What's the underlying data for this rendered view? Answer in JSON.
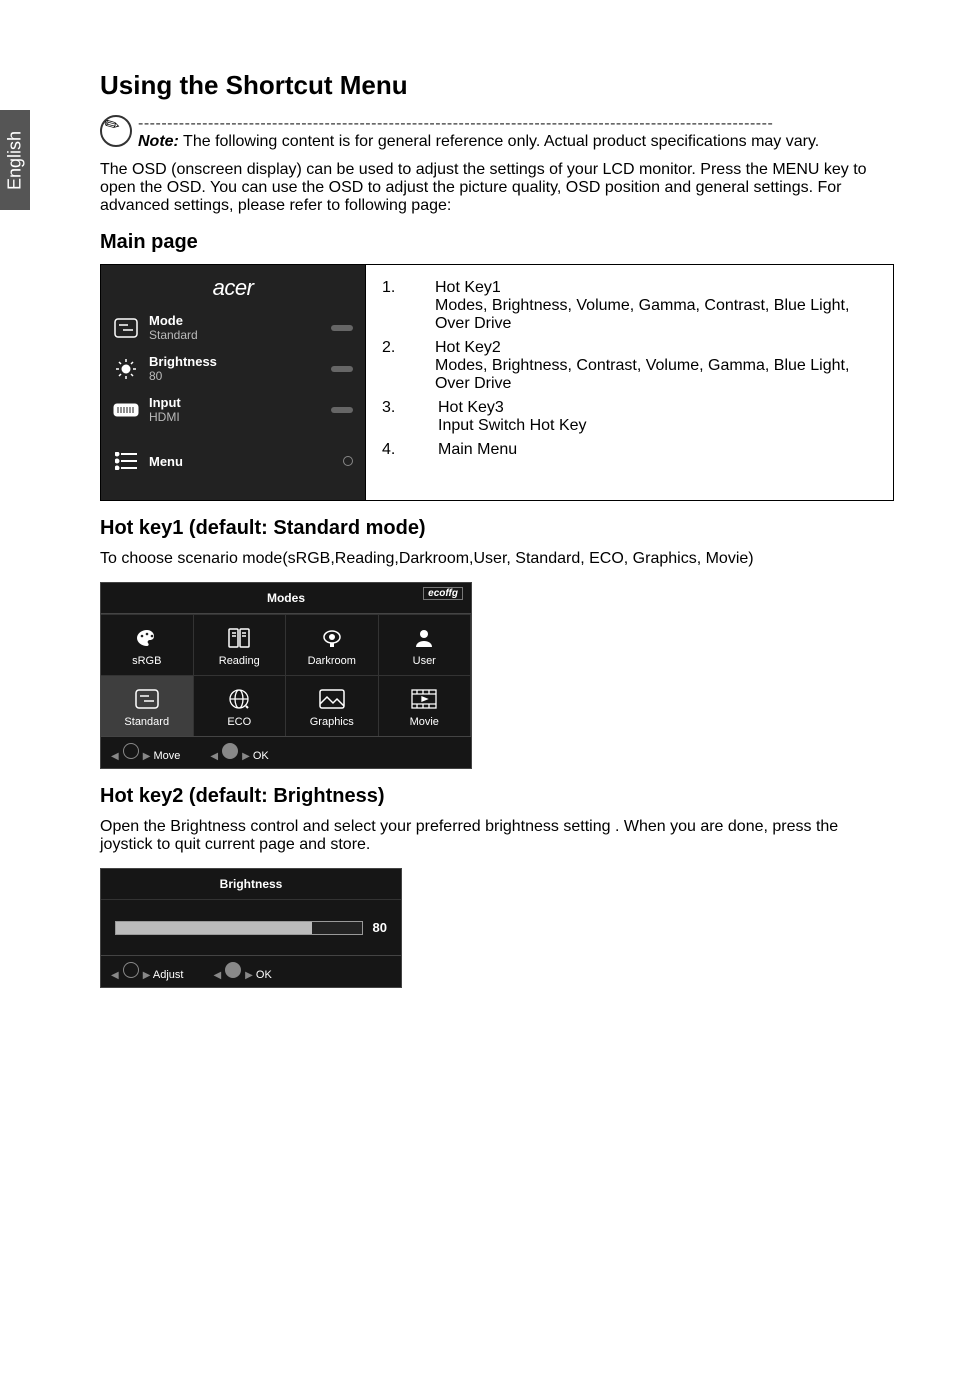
{
  "lang_tab": "English",
  "title": "Using the Shortcut Menu",
  "note_dashes": "-------------------------------------------------------------------------------------------------------------",
  "note_label": "Note:",
  "note_text": " The following content is for general reference only. Actual product specifications may vary.",
  "intro": "The OSD (onscreen display) can be used to adjust the settings of your LCD monitor. Press the MENU key to open the OSD. You can use the OSD to adjust the picture quality, OSD position and general settings. For advanced settings, please refer to following page:",
  "main_page_heading": "Main page",
  "osd": {
    "brand": "acer",
    "items": [
      {
        "label": "Mode",
        "sub": "Standard"
      },
      {
        "label": "Brightness",
        "sub": "80"
      },
      {
        "label": "Input",
        "sub": "HDMI"
      },
      {
        "label": "Menu",
        "sub": ""
      }
    ]
  },
  "desc": [
    {
      "n": "1.",
      "t": "Hot Key1\nModes, Brightness, Volume, Gamma, Contrast, Blue Light, Over Drive"
    },
    {
      "n": "2.",
      "t": "Hot Key2\nModes, Brightness, Contrast, Volume, Gamma, Blue Light, Over Drive"
    },
    {
      "n": "3.",
      "t": "Hot Key3\nInput Switch Hot Key"
    },
    {
      "n": "4.",
      "t": "Main Menu"
    }
  ],
  "hk1_heading": "Hot key1 (default: Standard mode)",
  "hk1_text": "To choose scenario mode(sRGB,Reading,Darkroom,User,  Standard, ECO, Graphics, Movie)",
  "modes_title": "Modes",
  "modes_energy": "ecoffg",
  "modes": [
    {
      "name": "sRGB",
      "icon": "palette"
    },
    {
      "name": "Reading",
      "icon": "book"
    },
    {
      "name": "Darkroom",
      "icon": "lamp"
    },
    {
      "name": "User",
      "icon": "user"
    },
    {
      "name": "Standard",
      "icon": "standard",
      "selected": true
    },
    {
      "name": "ECO",
      "icon": "globe"
    },
    {
      "name": "Graphics",
      "icon": "picture"
    },
    {
      "name": "Movie",
      "icon": "film"
    }
  ],
  "nav_move": "Move",
  "nav_ok": "OK",
  "hk2_heading": "Hot key2 (default: Brightness)",
  "hk2_text": "Open the Brightness control and select your preferred brightness setting . When you are done, press the joystick to quit current page and store.",
  "bright_title": "Brightness",
  "bright_value": "80",
  "nav_adjust": "Adjust",
  "chart_data": {
    "type": "bar",
    "title": "Brightness",
    "categories": [
      "Brightness"
    ],
    "values": [
      80
    ],
    "ylim": [
      0,
      100
    ]
  }
}
